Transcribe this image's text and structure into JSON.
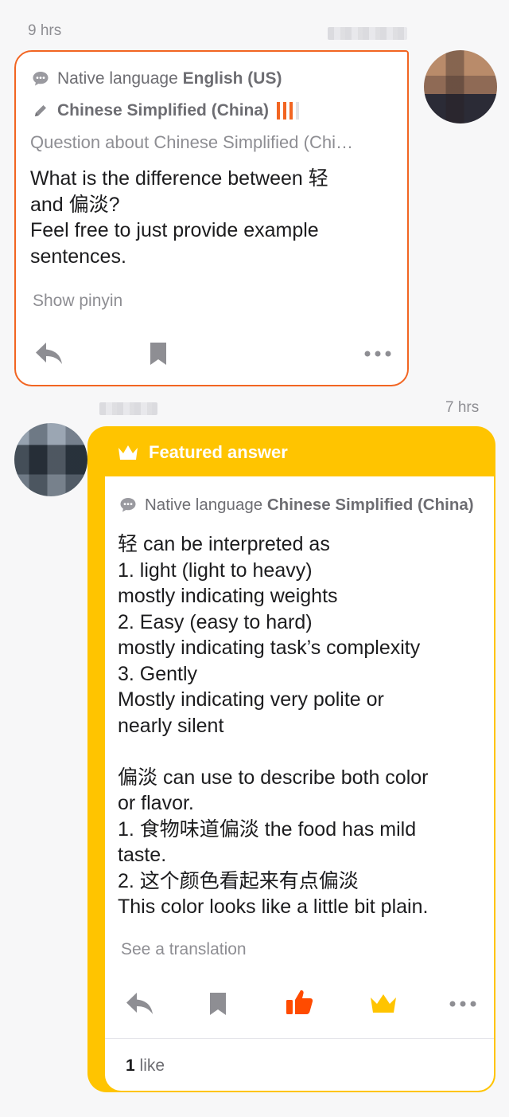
{
  "question": {
    "time": "9 hrs",
    "native_label": "Native language",
    "native_value": "English (US)",
    "learning_language": "Chinese Simplified (China)",
    "question_about": "Question about Chinese Simplified (Chi…",
    "text": "What is the difference between 轻\nand 偏淡?\nFeel free to just provide example\nsentences.",
    "show_pinyin": "Show pinyin",
    "icons": [
      "reply-icon",
      "bookmark-icon",
      "more-icon"
    ],
    "colors": {
      "accent": "#f26522"
    }
  },
  "answer": {
    "time": "7 hrs",
    "featured_label": "Featured answer",
    "native_label": "Native language",
    "native_value": "Chinese Simplified (China)",
    "text": "轻 can be interpreted as\n1. light (light to heavy)\nmostly indicating weights\n2. Easy (easy to hard)\nmostly indicating task’s complexity\n3. Gently\nMostly indicating very polite or\nnearly silent\n\n偏淡 can use to describe both color\nor flavor.\n1. 食物味道偏淡 the food has mild\ntaste.\n2. 这个颜色看起来有点偏淡\nThis color looks like a little bit plain.",
    "see_translation": "See a translation",
    "likes_count": "1",
    "likes_label": "like",
    "icons": [
      "reply-icon",
      "bookmark-icon",
      "thumbs-up-icon",
      "crown-icon",
      "more-icon"
    ],
    "colors": {
      "featured": "#ffc400",
      "like": "#ff4b00"
    }
  }
}
